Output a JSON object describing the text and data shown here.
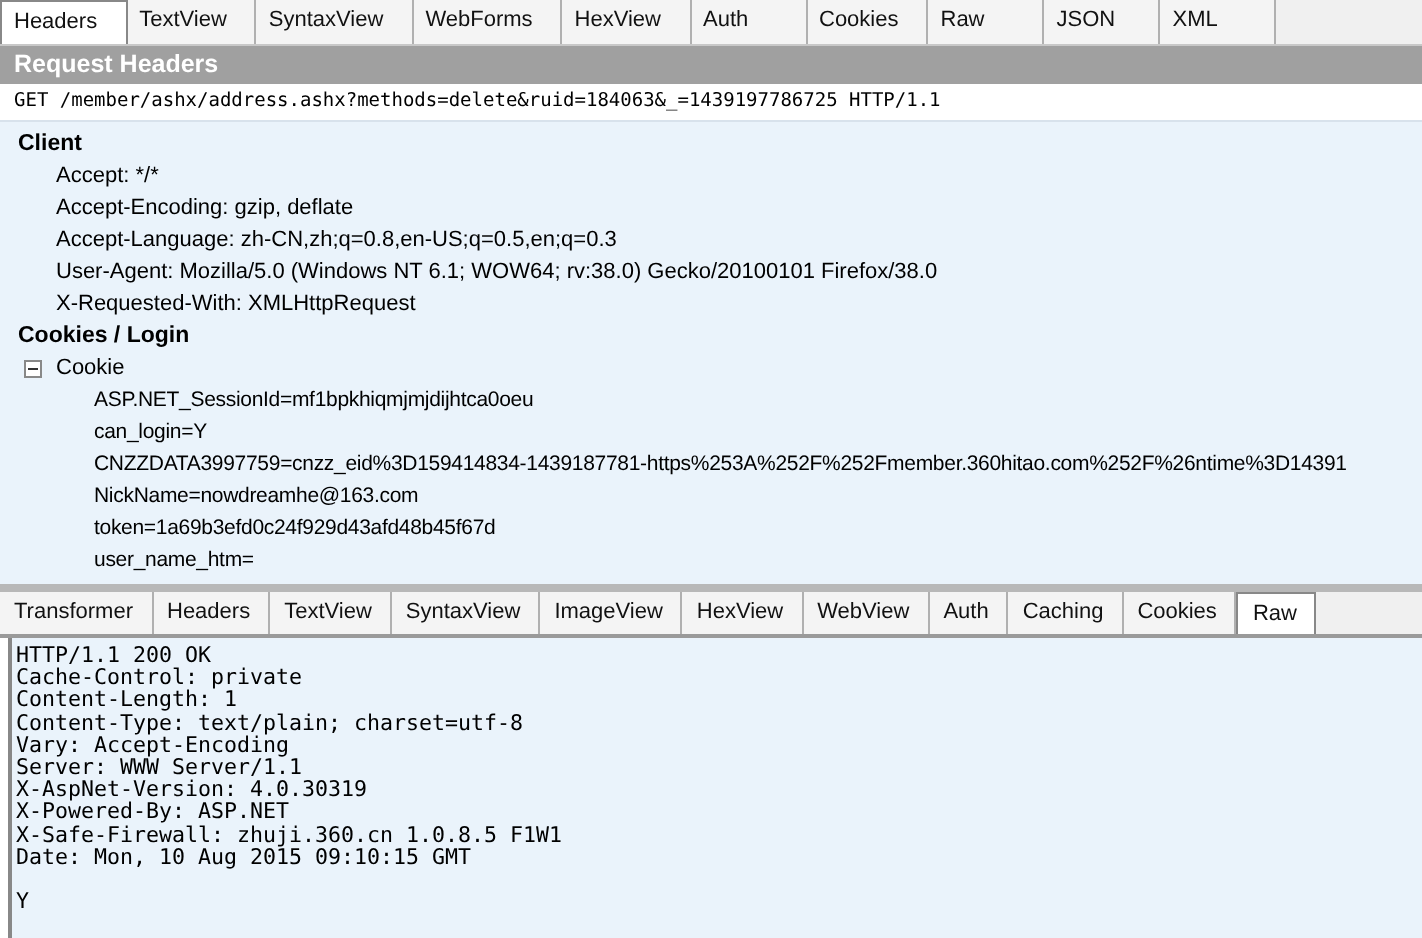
{
  "request_tabs": [
    {
      "label": "Headers",
      "selected": true
    },
    {
      "label": "TextView",
      "selected": false
    },
    {
      "label": "SyntaxView",
      "selected": false
    },
    {
      "label": "WebForms",
      "selected": false
    },
    {
      "label": "HexView",
      "selected": false
    },
    {
      "label": "Auth",
      "selected": false
    },
    {
      "label": "Cookies",
      "selected": false
    },
    {
      "label": "Raw",
      "selected": false
    },
    {
      "label": "JSON",
      "selected": false
    },
    {
      "label": "XML",
      "selected": false
    }
  ],
  "request_headers": {
    "title": "Request Headers",
    "request_line": "GET /member/ashx/address.ashx?methods=delete&ruid=184063&_=1439197786725 HTTP/1.1",
    "groups": [
      {
        "title": "Client",
        "items": [
          {
            "text": "Accept: */*"
          },
          {
            "text": "Accept-Encoding: gzip, deflate"
          },
          {
            "text": "Accept-Language: zh-CN,zh;q=0.8,en-US;q=0.5,en;q=0.3"
          },
          {
            "text": "User-Agent: Mozilla/5.0 (Windows NT 6.1; WOW64; rv:38.0) Gecko/20100101 Firefox/38.0"
          },
          {
            "text": "X-Requested-With: XMLHttpRequest"
          }
        ]
      },
      {
        "title": "Cookies / Login",
        "items": [
          {
            "text": "Cookie",
            "expanded": true,
            "children": [
              {
                "text": "ASP.NET_SessionId=mf1bpkhiqmjmjdijhtca0oeu"
              },
              {
                "text": "can_login=Y"
              },
              {
                "text": "CNZZDATA3997759=cnzz_eid%3D159414834-1439187781-https%253A%252F%252Fmember.360hitao.com%252F%26ntime%3D14391"
              },
              {
                "text": "NickName=nowdreamhe@163.com"
              },
              {
                "text": "token=1a69b3efd0c24f929d43afd48b45f67d"
              },
              {
                "text": "user_name_htm="
              }
            ]
          }
        ]
      }
    ]
  },
  "response_tabs": [
    {
      "label": "Transformer",
      "selected": false
    },
    {
      "label": "Headers",
      "selected": false
    },
    {
      "label": "TextView",
      "selected": false
    },
    {
      "label": "SyntaxView",
      "selected": false
    },
    {
      "label": "ImageView",
      "selected": false
    },
    {
      "label": "HexView",
      "selected": false
    },
    {
      "label": "WebView",
      "selected": false
    },
    {
      "label": "Auth",
      "selected": false
    },
    {
      "label": "Caching",
      "selected": false
    },
    {
      "label": "Cookies",
      "selected": false
    },
    {
      "label": "Raw",
      "selected": true
    }
  ],
  "response_raw": {
    "headers": [
      "HTTP/1.1 200 OK",
      "Cache-Control: private",
      "Content-Length: 1",
      "Content-Type: text/plain; charset=utf-8",
      "Vary: Accept-Encoding",
      "Server: WWW Server/1.1",
      "X-AspNet-Version: 4.0.30319",
      "X-Powered-By: ASP.NET",
      "X-Safe-Firewall: zhuji.360.cn 1.0.8.5 F1W1",
      "Date: Mon, 10 Aug 2015 09:10:15 GMT"
    ],
    "body": "Y"
  }
}
